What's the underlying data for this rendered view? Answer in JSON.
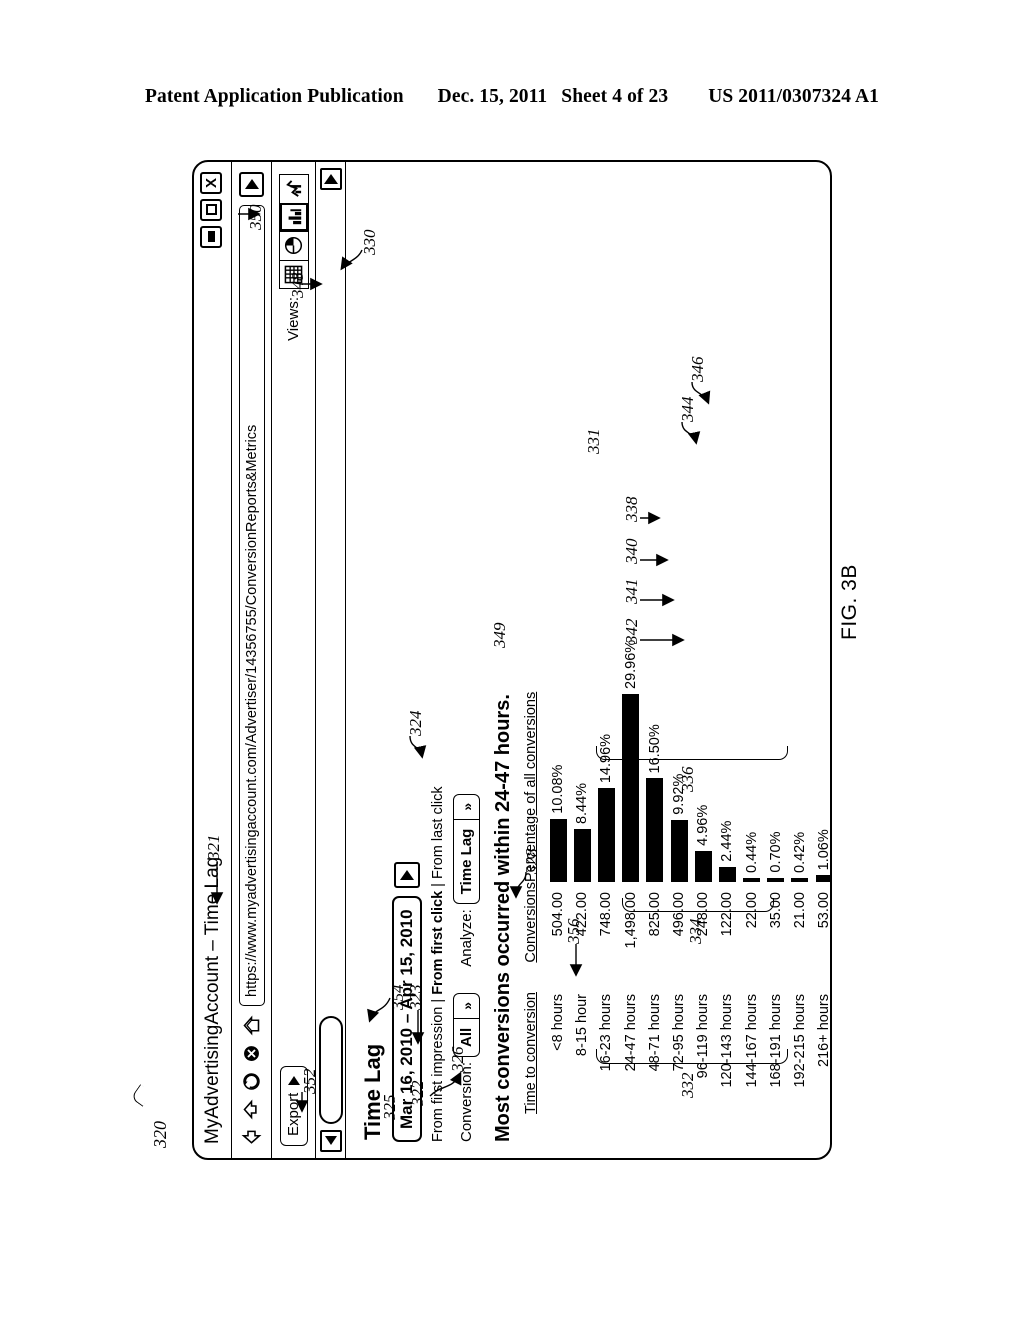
{
  "publication_header": {
    "left": "Patent Application Publication",
    "date": "Dec. 15, 2011",
    "sheet": "Sheet 4 of 23",
    "number": "US 2011/0307324 A1"
  },
  "figure": {
    "label": "FIG. 3B",
    "root_numeral": "320"
  },
  "window": {
    "title": "MyAdvertisingAccount – Time Lag",
    "title_numeral": "321",
    "buttons": {
      "minimize": "minimize",
      "maximize": "maximize",
      "close": "X"
    }
  },
  "navbar": {
    "url": "https://www.myadvertisingaccount.com/Advertiser/14356755/ConversionReports&Metrics",
    "go_numeral": "350",
    "icons": [
      "back-arrow-icon",
      "forward-arrow-icon",
      "refresh-icon",
      "stop-icon",
      "home-icon"
    ]
  },
  "toolbar": {
    "export_label": "Export",
    "export_numeral": "352",
    "views_label": "Views:",
    "views_numeral": "348",
    "view_buttons": [
      "table-view-icon",
      "pie-chart-view-icon",
      "bar-chart-view-icon",
      "line-chart-view-icon"
    ],
    "selected_view": "bar-chart-view-icon",
    "selected_view_numeral": "330",
    "page_numeral": "325"
  },
  "scrollbar": {
    "left_arrow": "scroll-left-icon",
    "right_arrow": "scroll-right-icon",
    "thumb_numeral": "354",
    "content_numeral": "322"
  },
  "report": {
    "title": "Time Lag",
    "title_numeral": "323",
    "date_range": "Mar 16, 2010 – Apr 15, 2010",
    "date_go_numeral": "324",
    "attribution_numeral": "326",
    "attribution": {
      "option1": "From first impression",
      "option2": "From first click",
      "option3": "From last click",
      "selected": "From first click",
      "separator": "|"
    },
    "conversion_filter_label": "Conversion:",
    "conversion_filter_value": "All",
    "conversion_filter_numeral": "328",
    "analyze_label": "Analyze:",
    "analyze_value": "Time Lag",
    "analyze_numeral": "349",
    "headline": "Most conversions occurred within 24-47 hours.",
    "headline_numeral": "356",
    "chart_numeral": "331",
    "columns": {
      "time": "Time to conversion",
      "conversions": "Conversions",
      "percentage": "Percentage of all conversions"
    },
    "column_numerals": {
      "time": "332",
      "conversions": "334",
      "percentage": "336"
    },
    "callouts": {
      "bar_342": "342",
      "bar_341": "341",
      "bar_340": "340",
      "bar_338": "338",
      "bar_344": "344",
      "bar_346": "346"
    }
  },
  "chart_data": {
    "type": "bar",
    "title": "Most conversions occurred within 24-47 hours.",
    "xlabel": "Time to conversion",
    "ylabel": "Percentage of all conversions",
    "categories": [
      "<8 hours",
      "8-15 hour",
      "16-23 hours",
      "24-47 hours",
      "48-71 hours",
      "72-95 hours",
      "96-119 hours",
      "120-143 hours",
      "144-167 hours",
      "168-191 hours",
      "192-215 hours",
      "216+ hours"
    ],
    "conversions": [
      "504.00",
      "422.00",
      "748.00",
      "1,498.00",
      "825.00",
      "496.00",
      "248.00",
      "122.00",
      "22.00",
      "35.00",
      "21.00",
      "53.00"
    ],
    "percentages": [
      "10.08%",
      "8.44%",
      "14.96%",
      "29.96%",
      "16.50%",
      "9.92%",
      "4.96%",
      "2.44%",
      "0.44%",
      "0.70%",
      "0.42%",
      "1.06%"
    ],
    "values": [
      10.08,
      8.44,
      14.96,
      29.96,
      16.5,
      9.92,
      4.96,
      2.44,
      0.44,
      0.7,
      0.42,
      1.06
    ],
    "ylim": [
      0,
      30
    ],
    "grid": false,
    "legend": "none"
  }
}
